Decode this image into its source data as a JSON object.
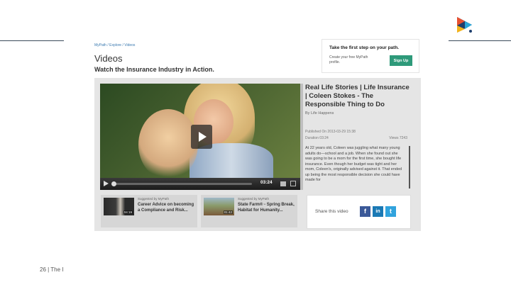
{
  "slide": {
    "footer": "26 | The I"
  },
  "site": {
    "breadcrumb": "MyPath / Explore / Videos",
    "page_title": "Videos",
    "subtitle": "Watch the Insurance Industry in Action."
  },
  "cta": {
    "heading": "Take the first step on your path.",
    "text": "Create your free MyPath profile.",
    "button": "Sign Up"
  },
  "player": {
    "time": "03:24",
    "progress": 0
  },
  "video_info": {
    "title": "Real Life Stories | Life Insurance | Coleen Stokes - The Responsible Thing to Do",
    "by": "By Life Happens",
    "published": "Published On 2013-03-29 15:38",
    "duration": "Duration 03:24",
    "views": "Views 7243",
    "description": "At 22 years old, Coleen was juggling what many young adults do—school and a job. When she found out she was going to be a mom for the first time, she bought life insurance. Even though her budget was tight and her mom, Coleen's, originally advised against it. That ended up being the most responsible decision she could have made for"
  },
  "suggested": [
    {
      "label": "Suggested by MyPath",
      "title": "Career Advice on becoming a Compliance and Risk...",
      "duration": "04:19"
    },
    {
      "label": "Suggested by MyPath",
      "title": "State Farm® - Spring Break, Habitat for Humanity...",
      "duration": "01:42"
    }
  ],
  "share": {
    "label": "Share this video",
    "facebook": "f",
    "linkedin": "in",
    "twitter": "t"
  },
  "colors": {
    "signup_button": "#2e9a7a",
    "facebook": "#3b5998",
    "linkedin": "#1a79b5",
    "twitter": "#31a3dd"
  }
}
